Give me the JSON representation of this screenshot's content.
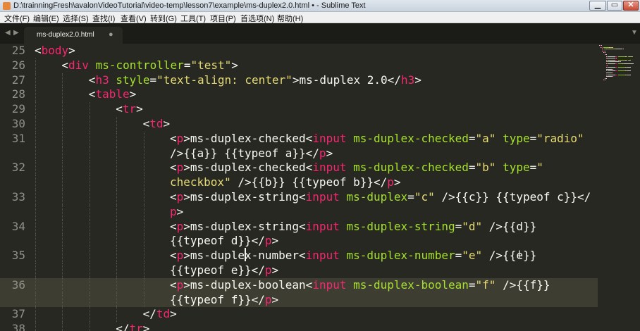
{
  "window": {
    "title": "D:\\trainningFresh\\avalonVideoTutorial\\video-temp\\lesson7\\example\\ms-duplex2.0.html • - Sublime Text",
    "min_glyph": "▁",
    "max_glyph": "▭",
    "close_glyph": "✕"
  },
  "menu": [
    {
      "label": "文件(F)"
    },
    {
      "label": "编辑(E)"
    },
    {
      "label": "选择(S)"
    },
    {
      "label": "查找(I)"
    },
    {
      "label": "查看(V)"
    },
    {
      "label": "转到(G)"
    },
    {
      "label": "工具(T)"
    },
    {
      "label": "项目(P)"
    },
    {
      "label": "首选项(N)"
    },
    {
      "label": "帮助(H)"
    }
  ],
  "tabs": {
    "nav_left": "◀",
    "nav_right": "▶",
    "active": {
      "label": "ms-duplex2.0.html",
      "dirty_glyph": "●"
    },
    "dropdown": "▼"
  },
  "colors": {
    "background": "#272822",
    "tag": "#f92672",
    "attribute": "#a6e22e",
    "string": "#e6db74",
    "text": "#f8f8f2",
    "gutter": "#90908a",
    "current_line": "#3e3d32"
  },
  "editor": {
    "current_line_number": "36",
    "lines": [
      {
        "num": "25",
        "indent": 0,
        "segments": [
          {
            "t": "<",
            "c": "punct"
          },
          {
            "t": "body",
            "c": "tag"
          },
          {
            "t": ">",
            "c": "punct"
          }
        ]
      },
      {
        "num": "26",
        "indent": 1,
        "segments": [
          {
            "t": "<",
            "c": "punct"
          },
          {
            "t": "div",
            "c": "tag"
          },
          {
            "t": " ",
            "c": "text"
          },
          {
            "t": "ms-controller",
            "c": "attr"
          },
          {
            "t": "=",
            "c": "punct"
          },
          {
            "t": "\"test\"",
            "c": "str"
          },
          {
            "t": ">",
            "c": "punct"
          }
        ]
      },
      {
        "num": "27",
        "indent": 2,
        "segments": [
          {
            "t": "<",
            "c": "punct"
          },
          {
            "t": "h3",
            "c": "tag"
          },
          {
            "t": " ",
            "c": "text"
          },
          {
            "t": "style",
            "c": "attr"
          },
          {
            "t": "=",
            "c": "punct"
          },
          {
            "t": "\"text-align: center\"",
            "c": "str"
          },
          {
            "t": ">ms-duplex 2.0</",
            "c": "punct"
          },
          {
            "t": "h3",
            "c": "tag"
          },
          {
            "t": ">",
            "c": "punct"
          }
        ]
      },
      {
        "num": "28",
        "indent": 2,
        "segments": [
          {
            "t": "<",
            "c": "punct"
          },
          {
            "t": "table",
            "c": "tag"
          },
          {
            "t": ">",
            "c": "punct"
          }
        ]
      },
      {
        "num": "29",
        "indent": 3,
        "segments": [
          {
            "t": "<",
            "c": "punct"
          },
          {
            "t": "tr",
            "c": "tag"
          },
          {
            "t": ">",
            "c": "punct"
          }
        ]
      },
      {
        "num": "30",
        "indent": 4,
        "segments": [
          {
            "t": "<",
            "c": "punct"
          },
          {
            "t": "td",
            "c": "tag"
          },
          {
            "t": ">",
            "c": "punct"
          }
        ]
      },
      {
        "num": "31",
        "indent": 5,
        "segments": [
          {
            "t": "<",
            "c": "punct"
          },
          {
            "t": "p",
            "c": "tag"
          },
          {
            "t": ">ms-duplex-checked<",
            "c": "punct"
          },
          {
            "t": "input",
            "c": "tag"
          },
          {
            "t": " ",
            "c": "text"
          },
          {
            "t": "ms-duplex-checked",
            "c": "attr"
          },
          {
            "t": "=",
            "c": "punct"
          },
          {
            "t": "\"a\"",
            "c": "str"
          },
          {
            "t": " ",
            "c": "text"
          },
          {
            "t": "type",
            "c": "attr"
          },
          {
            "t": "=",
            "c": "punct"
          },
          {
            "t": "\"radio\"",
            "c": "str"
          }
        ]
      },
      {
        "num": "",
        "indent": 5,
        "segments": [
          {
            "t": "/>{{a}} {{typeof a}}</",
            "c": "punct"
          },
          {
            "t": "p",
            "c": "tag"
          },
          {
            "t": ">",
            "c": "punct"
          }
        ]
      },
      {
        "num": "32",
        "indent": 5,
        "segments": [
          {
            "t": "<",
            "c": "punct"
          },
          {
            "t": "p",
            "c": "tag"
          },
          {
            "t": ">ms-duplex-checked<",
            "c": "punct"
          },
          {
            "t": "input",
            "c": "tag"
          },
          {
            "t": " ",
            "c": "text"
          },
          {
            "t": "ms-duplex-checked",
            "c": "attr"
          },
          {
            "t": "=",
            "c": "punct"
          },
          {
            "t": "\"b\"",
            "c": "str"
          },
          {
            "t": " ",
            "c": "text"
          },
          {
            "t": "type",
            "c": "attr"
          },
          {
            "t": "=",
            "c": "punct"
          },
          {
            "t": "\"",
            "c": "str"
          }
        ]
      },
      {
        "num": "",
        "indent": 5,
        "segments": [
          {
            "t": "checkbox\"",
            "c": "str"
          },
          {
            "t": " />{{b}} {{typeof b}}</",
            "c": "punct"
          },
          {
            "t": "p",
            "c": "tag"
          },
          {
            "t": ">",
            "c": "punct"
          }
        ]
      },
      {
        "num": "33",
        "indent": 5,
        "segments": [
          {
            "t": "<",
            "c": "punct"
          },
          {
            "t": "p",
            "c": "tag"
          },
          {
            "t": ">ms-duplex-string<",
            "c": "punct"
          },
          {
            "t": "input",
            "c": "tag"
          },
          {
            "t": " ",
            "c": "text"
          },
          {
            "t": "ms-duplex",
            "c": "attr"
          },
          {
            "t": "=",
            "c": "punct"
          },
          {
            "t": "\"c\"",
            "c": "str"
          },
          {
            "t": " />{{c}} {{typeof c}}</",
            "c": "punct"
          }
        ]
      },
      {
        "num": "",
        "indent": 5,
        "segments": [
          {
            "t": "p",
            "c": "tag"
          },
          {
            "t": ">",
            "c": "punct"
          }
        ]
      },
      {
        "num": "34",
        "indent": 5,
        "segments": [
          {
            "t": "<",
            "c": "punct"
          },
          {
            "t": "p",
            "c": "tag"
          },
          {
            "t": ">ms-duplex-string<",
            "c": "punct"
          },
          {
            "t": "input",
            "c": "tag"
          },
          {
            "t": " ",
            "c": "text"
          },
          {
            "t": "ms-duplex-string",
            "c": "attr"
          },
          {
            "t": "=",
            "c": "punct"
          },
          {
            "t": "\"d\"",
            "c": "str"
          },
          {
            "t": " />{{d}}",
            "c": "punct"
          }
        ]
      },
      {
        "num": "",
        "indent": 5,
        "segments": [
          {
            "t": "{{typeof d}}</",
            "c": "punct"
          },
          {
            "t": "p",
            "c": "tag"
          },
          {
            "t": ">",
            "c": "punct"
          }
        ]
      },
      {
        "num": "35",
        "indent": 5,
        "segments": [
          {
            "t": "<",
            "c": "punct"
          },
          {
            "t": "p",
            "c": "tag"
          },
          {
            "t": ">ms-duplex-number<",
            "c": "punct"
          },
          {
            "t": "input",
            "c": "tag"
          },
          {
            "t": " ",
            "c": "text"
          },
          {
            "t": "ms-duplex-number",
            "c": "attr"
          },
          {
            "t": "=",
            "c": "punct"
          },
          {
            "t": "\"e\"",
            "c": "str"
          },
          {
            "t": " />{{e}}",
            "c": "punct"
          }
        ]
      },
      {
        "num": "",
        "indent": 5,
        "segments": [
          {
            "t": "{{typeof e}}</",
            "c": "punct"
          },
          {
            "t": "p",
            "c": "tag"
          },
          {
            "t": ">",
            "c": "punct"
          }
        ]
      },
      {
        "num": "36",
        "indent": 5,
        "segments": [
          {
            "t": "<",
            "c": "punct"
          },
          {
            "t": "p",
            "c": "tag"
          },
          {
            "t": ">ms-duplex-boolean<",
            "c": "punct"
          },
          {
            "t": "input",
            "c": "tag"
          },
          {
            "t": " ",
            "c": "text"
          },
          {
            "t": "ms-duplex-boolean",
            "c": "attr"
          },
          {
            "t": "=",
            "c": "punct"
          },
          {
            "t": "\"f\"",
            "c": "str"
          },
          {
            "t": " />{{f}}",
            "c": "punct"
          }
        ]
      },
      {
        "num": "",
        "indent": 5,
        "segments": [
          {
            "t": "{{typeof f}}</",
            "c": "punct"
          },
          {
            "t": "p",
            "c": "tag"
          },
          {
            "t": ">",
            "c": "punct"
          }
        ]
      },
      {
        "num": "37",
        "indent": 4,
        "segments": [
          {
            "t": "</",
            "c": "punct"
          },
          {
            "t": "td",
            "c": "tag"
          },
          {
            "t": ">",
            "c": "punct"
          }
        ]
      },
      {
        "num": "38",
        "indent": 3,
        "segments": [
          {
            "t": "</",
            "c": "punct"
          },
          {
            "t": "tr",
            "c": "tag"
          },
          {
            "t": ">",
            "c": "punct"
          }
        ]
      }
    ]
  }
}
